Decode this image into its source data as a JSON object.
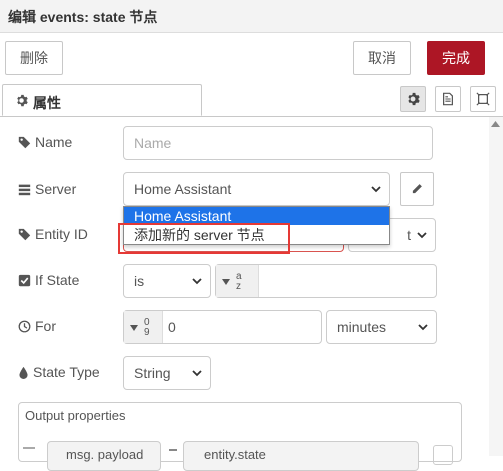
{
  "header": {
    "title": "编辑 events: state 节点",
    "delete_label": "删除",
    "cancel_label": "取消",
    "done_label": "完成"
  },
  "tabs": {
    "properties_label": "属性"
  },
  "fields": {
    "name": {
      "label": "Name",
      "placeholder": "Name"
    },
    "server": {
      "label": "Server",
      "value": "Home Assistant"
    },
    "entity_id": {
      "label": "Entity ID",
      "match_value": "t"
    },
    "if_state": {
      "label": "If State",
      "operator": "is",
      "type_symbol": "a z"
    },
    "for": {
      "label": "For",
      "type_symbol": "0 9",
      "value": "0",
      "unit": "minutes"
    },
    "state_type": {
      "label": "State Type",
      "value": "String"
    }
  },
  "dropdown": {
    "options": [
      "Home Assistant",
      "添加新的 server 节点"
    ],
    "selected": "Home Assistant"
  },
  "output": {
    "header": "Output properties",
    "row_left": "msg. payload",
    "row_right": "entity.state"
  },
  "colors": {
    "primary": "#ad1625",
    "highlight": "#1e73e8",
    "annotation": "#e53935"
  }
}
